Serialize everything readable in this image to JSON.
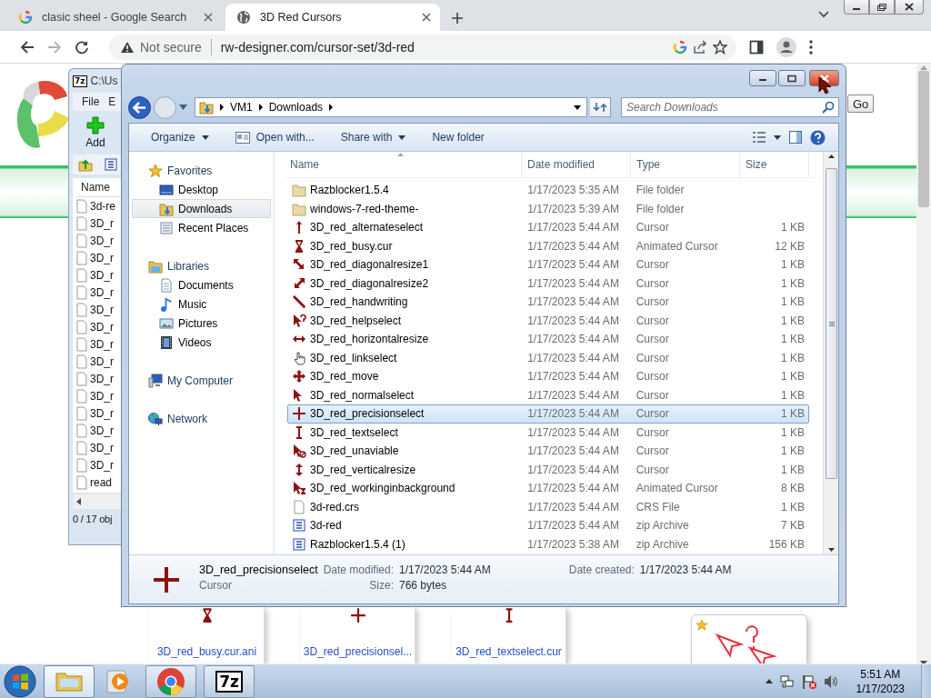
{
  "browser": {
    "tabs": [
      {
        "title": "clasic sheel - Google Search",
        "kind": "google",
        "selected": false
      },
      {
        "title": "3D Red Cursors",
        "kind": "globe",
        "selected": true
      }
    ],
    "address": {
      "security": "Not secure",
      "url": "rw-designer.com/cursor-set/3d-red"
    }
  },
  "web_page": {
    "go_button": "Go",
    "thumbnails": [
      {
        "label": "3D_red_busy.cur.ani",
        "kind": "busy"
      },
      {
        "label": "3D_red_precisionsel...",
        "kind": "precision"
      },
      {
        "label": "3D_red_textselect.cur",
        "kind": "text"
      }
    ]
  },
  "zip_window": {
    "icon_text": "7z",
    "title": "C:\\Us",
    "menu": [
      "File",
      "E"
    ],
    "add_button": "Add",
    "column": "Name",
    "rows": [
      "3d-re",
      "3D_r",
      "3D_r",
      "3D_r",
      "3D_r",
      "3D_r",
      "3D_r",
      "3D_r",
      "3D_r",
      "3D_r",
      "3D_r",
      "3D_r",
      "3D_r",
      "3D_r",
      "3D_r",
      "3D_r",
      "read"
    ],
    "status": "0 / 17 obj"
  },
  "explorer": {
    "breadcrumb": [
      "VM1",
      "Downloads"
    ],
    "search": {
      "placeholder": "Search Downloads"
    },
    "commands": [
      {
        "label": "Organize",
        "has_menu": true
      },
      {
        "label": "Open with...",
        "has_menu": false
      },
      {
        "label": "Share with",
        "has_menu": true
      },
      {
        "label": "New folder",
        "has_menu": false
      }
    ],
    "nav": [
      {
        "label": "Favorites",
        "kind": "favorites",
        "selected": false,
        "children": [
          {
            "label": "Desktop",
            "kind": "desktop",
            "selected": false
          },
          {
            "label": "Downloads",
            "kind": "downloads",
            "selected": true
          },
          {
            "label": "Recent Places",
            "kind": "recent",
            "selected": false
          }
        ]
      },
      {
        "label": "Libraries",
        "kind": "libraries",
        "selected": false,
        "children": [
          {
            "label": "Documents",
            "kind": "documents",
            "selected": false
          },
          {
            "label": "Music",
            "kind": "music",
            "selected": false
          },
          {
            "label": "Pictures",
            "kind": "pictures",
            "selected": false
          },
          {
            "label": "Videos",
            "kind": "videos",
            "selected": false
          }
        ]
      },
      {
        "label": "My Computer",
        "kind": "computer",
        "selected": false
      },
      {
        "label": "Network",
        "kind": "network",
        "selected": false
      }
    ],
    "columns": [
      "Name",
      "Date modified",
      "Type",
      "Size"
    ],
    "files": [
      {
        "name": "Razblocker1.5.4",
        "date": "1/17/2023 5:35 AM",
        "type": "File folder",
        "kind": "folder",
        "selected": false
      },
      {
        "name": "windows-7-red-theme-",
        "date": "1/17/2023 5:39 AM",
        "type": "File folder",
        "kind": "folder",
        "selected": false
      },
      {
        "name": "3D_red_alternateselect",
        "date": "1/17/2023 5:44 AM",
        "type": "Cursor",
        "size": "1 KB",
        "kind": "alternate",
        "selected": false
      },
      {
        "name": "3D_red_busy.cur",
        "date": "1/17/2023 5:44 AM",
        "type": "Animated Cursor",
        "size": "12 KB",
        "kind": "busy",
        "selected": false
      },
      {
        "name": "3D_red_diagonalresize1",
        "date": "1/17/2023 5:44 AM",
        "type": "Cursor",
        "size": "1 KB",
        "kind": "diagonal1",
        "selected": false
      },
      {
        "name": "3D_red_diagonalresize2",
        "date": "1/17/2023 5:44 AM",
        "type": "Cursor",
        "size": "1 KB",
        "kind": "diagonal2",
        "selected": false
      },
      {
        "name": "3D_red_handwriting",
        "date": "1/17/2023 5:44 AM",
        "type": "Cursor",
        "size": "1 KB",
        "kind": "pen",
        "selected": false
      },
      {
        "name": "3D_red_helpselect",
        "date": "1/17/2023 5:44 AM",
        "type": "Cursor",
        "size": "1 KB",
        "kind": "help",
        "selected": false
      },
      {
        "name": "3D_red_horizontalresize",
        "date": "1/17/2023 5:44 AM",
        "type": "Cursor",
        "size": "1 KB",
        "kind": "hresize",
        "selected": false
      },
      {
        "name": "3D_red_linkselect",
        "date": "1/17/2023 5:44 AM",
        "type": "Cursor",
        "size": "1 KB",
        "kind": "hand",
        "selected": false
      },
      {
        "name": "3D_red_move",
        "date": "1/17/2023 5:44 AM",
        "type": "Cursor",
        "size": "1 KB",
        "kind": "move",
        "selected": false
      },
      {
        "name": "3D_red_normalselect",
        "date": "1/17/2023 5:44 AM",
        "type": "Cursor",
        "size": "1 KB",
        "kind": "pointer",
        "selected": false
      },
      {
        "name": "3D_red_precisionselect",
        "date": "1/17/2023 5:44 AM",
        "type": "Cursor",
        "size": "1 KB",
        "kind": "precision",
        "selected": true
      },
      {
        "name": "3D_red_textselect",
        "date": "1/17/2023 5:44 AM",
        "type": "Cursor",
        "size": "1 KB",
        "kind": "text",
        "selected": false
      },
      {
        "name": "3D_red_unaviable",
        "date": "1/17/2023 5:44 AM",
        "type": "Cursor",
        "size": "1 KB",
        "kind": "unavailable",
        "selected": false
      },
      {
        "name": "3D_red_verticalresize",
        "date": "1/17/2023 5:44 AM",
        "type": "Cursor",
        "size": "1 KB",
        "kind": "vresize",
        "selected": false
      },
      {
        "name": "3D_red_workinginbackground",
        "date": "1/17/2023 5:44 AM",
        "type": "Animated Cursor",
        "size": "8 KB",
        "kind": "working",
        "selected": false
      },
      {
        "name": "3d-red.crs",
        "date": "1/17/2023 5:44 AM",
        "type": "CRS File",
        "size": "1 KB",
        "kind": "file",
        "selected": false
      },
      {
        "name": "3d-red",
        "date": "1/17/2023 5:44 AM",
        "type": "zip Archive",
        "size": "7 KB",
        "kind": "zip",
        "selected": false
      },
      {
        "name": "Razblocker1.5.4 (1)",
        "date": "1/17/2023 5:38 AM",
        "type": "zip Archive",
        "size": "156 KB",
        "kind": "zip",
        "selected": false
      }
    ],
    "details": {
      "name": "3D_red_precisionselect",
      "type": "Cursor",
      "kind": "precision",
      "modified_label": "Date modified:",
      "modified": "1/17/2023 5:44 AM",
      "created_label": "Date created:",
      "created": "1/17/2023 5:44 AM",
      "size_label": "Size:",
      "size": "766 bytes"
    }
  },
  "taskbar": {
    "apps": [
      {
        "kind": "explorer",
        "running": true,
        "selected": true
      },
      {
        "kind": "media",
        "running": false,
        "selected": false
      },
      {
        "kind": "chrome",
        "running": true,
        "selected": false
      },
      {
        "kind": "archiver",
        "label": "7z",
        "running": true,
        "selected": false
      }
    ],
    "time": "5:51 AM",
    "date": "1/17/2023"
  }
}
